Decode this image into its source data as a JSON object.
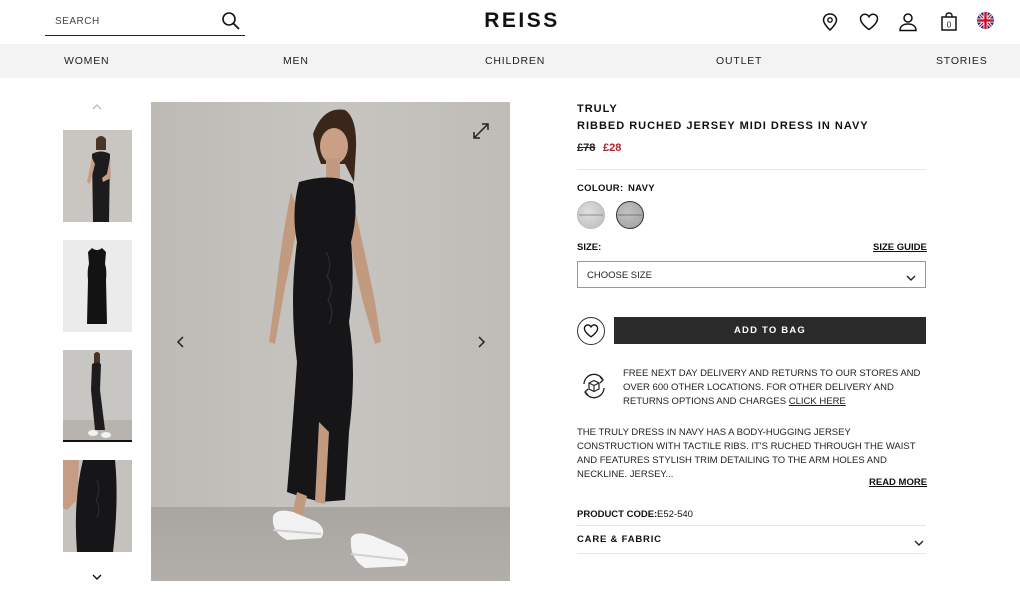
{
  "header": {
    "search_placeholder": "SEARCH",
    "logo": "REISS",
    "bag_count": "0",
    "icons": [
      "search-icon",
      "store-locator-icon",
      "wishlist-icon",
      "account-icon",
      "bag-icon",
      "uk-flag-icon"
    ]
  },
  "nav": {
    "items": [
      {
        "label": "WOMEN"
      },
      {
        "label": "MEN"
      },
      {
        "label": "CHILDREN"
      },
      {
        "label": "OUTLET"
      },
      {
        "label": "STORIES"
      }
    ]
  },
  "gallery": {
    "thumbnails": 4,
    "active_thumbnail": 3
  },
  "product": {
    "brand": "TRULY",
    "title": "RIBBED RUCHED JERSEY MIDI DRESS IN NAVY",
    "price_old": "£78",
    "price_new": "£28",
    "colour_label": "COLOUR:",
    "colour_value": "NAVY",
    "size_label": "SIZE:",
    "size_guide": "SIZE GUIDE",
    "size_select": "CHOOSE SIZE",
    "add_to_bag": "ADD TO BAG",
    "delivery_text": "FREE NEXT DAY DELIVERY AND RETURNS TO OUR STORES AND OVER 600 OTHER LOCATIONS. FOR OTHER DELIVERY AND RETURNS OPTIONS AND CHARGES",
    "delivery_link": "CLICK HERE",
    "description": "THE TRULY DRESS IN NAVY HAS A BODY-HUGGING JERSEY CONSTRUCTION WITH TACTILE RIBS. IT'S RUCHED THROUGH THE WAIST AND FEATURES STYLISH TRIM DETAILING TO THE ARM HOLES AND NECKLINE. JERSEY...",
    "read_more": "READ MORE",
    "code_label": "PRODUCT CODE:",
    "code_value": "E52-540",
    "care_label": "CARE & FABRIC"
  },
  "colors": {
    "sale_red": "#b3212e",
    "button_dark": "#2a2a2a",
    "nav_bg": "#f3f3f3"
  }
}
